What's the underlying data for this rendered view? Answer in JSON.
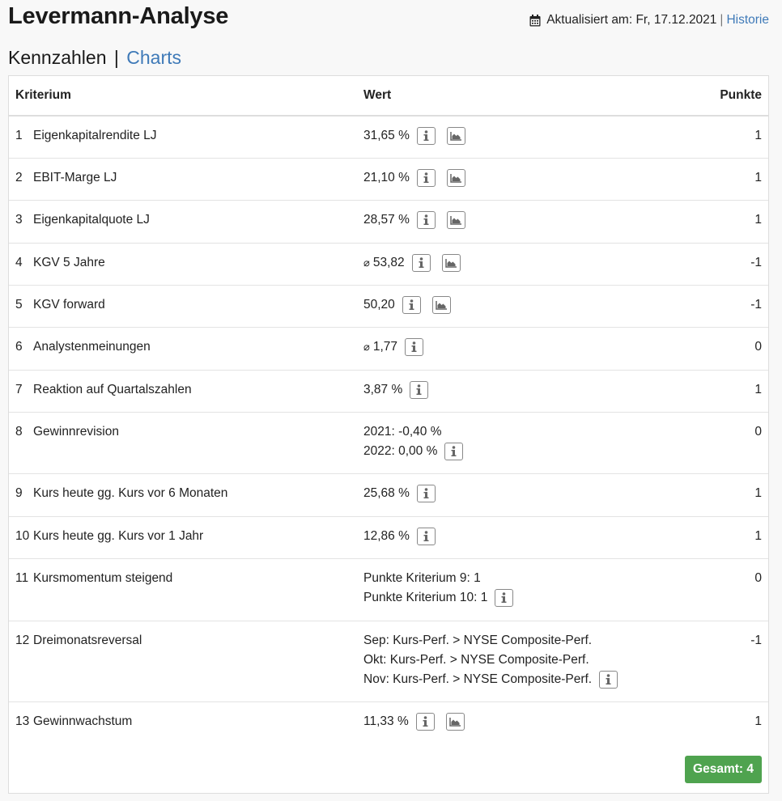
{
  "header": {
    "title": "Levermann-Analyse",
    "updated_label": "Aktualisiert am: Fr, 17.12.2021",
    "separator": "|",
    "history_link": "Historie",
    "calendar_icon": "calendar-icon"
  },
  "subnav": {
    "active": "Kennzahlen",
    "separator": "|",
    "link": "Charts"
  },
  "table": {
    "columns": [
      "Kriterium",
      "Wert",
      "Punkte"
    ],
    "rows": [
      {
        "num": "1",
        "criterion": "Eigenkapitalrendite LJ",
        "lines": [
          "31,65 %"
        ],
        "avg": false,
        "info": true,
        "chart": true,
        "points": "1"
      },
      {
        "num": "2",
        "criterion": "EBIT-Marge LJ",
        "lines": [
          "21,10 %"
        ],
        "avg": false,
        "info": true,
        "chart": true,
        "points": "1"
      },
      {
        "num": "3",
        "criterion": "Eigenkapitalquote LJ",
        "lines": [
          "28,57 %"
        ],
        "avg": false,
        "info": true,
        "chart": true,
        "points": "1"
      },
      {
        "num": "4",
        "criterion": "KGV 5 Jahre",
        "lines": [
          "53,82"
        ],
        "avg": true,
        "info": true,
        "chart": true,
        "points": "-1"
      },
      {
        "num": "5",
        "criterion": "KGV forward",
        "lines": [
          "50,20"
        ],
        "avg": false,
        "info": true,
        "chart": true,
        "points": "-1"
      },
      {
        "num": "6",
        "criterion": "Analystenmeinungen",
        "lines": [
          "1,77"
        ],
        "avg": true,
        "info": true,
        "chart": false,
        "points": "0"
      },
      {
        "num": "7",
        "criterion": "Reaktion auf Quartalszahlen",
        "lines": [
          "3,87 %"
        ],
        "avg": false,
        "info": true,
        "chart": false,
        "points": "1"
      },
      {
        "num": "8",
        "criterion": "Gewinnrevision",
        "lines": [
          "2021: -0,40 %",
          "2022: 0,00 %"
        ],
        "avg": false,
        "info": true,
        "chart": false,
        "points": "0"
      },
      {
        "num": "9",
        "criterion": "Kurs heute gg. Kurs vor 6 Monaten",
        "lines": [
          "25,68 %"
        ],
        "avg": false,
        "info": true,
        "chart": false,
        "points": "1"
      },
      {
        "num": "10",
        "criterion": "Kurs heute gg. Kurs vor 1 Jahr",
        "lines": [
          "12,86 %"
        ],
        "avg": false,
        "info": true,
        "chart": false,
        "points": "1"
      },
      {
        "num": "11",
        "criterion": "Kursmomentum steigend",
        "lines": [
          "Punkte Kriterium 9: 1",
          "Punkte Kriterium 10: 1"
        ],
        "avg": false,
        "info": true,
        "chart": false,
        "points": "0"
      },
      {
        "num": "12",
        "criterion": "Dreimonatsreversal",
        "lines": [
          "Sep: Kurs-Perf. > NYSE Composite-Perf.",
          "Okt: Kurs-Perf. > NYSE Composite-Perf.",
          "Nov: Kurs-Perf. > NYSE Composite-Perf."
        ],
        "avg": false,
        "info": true,
        "chart": false,
        "points": "-1"
      },
      {
        "num": "13",
        "criterion": "Gewinnwachstum",
        "lines": [
          "11,33 %"
        ],
        "avg": false,
        "info": true,
        "chart": true,
        "points": "1"
      }
    ],
    "avg_symbol": "⌀",
    "total_label": "Gesamt: 4"
  },
  "colors": {
    "link": "#3f7ab8",
    "total_badge": "#4fa34f"
  }
}
